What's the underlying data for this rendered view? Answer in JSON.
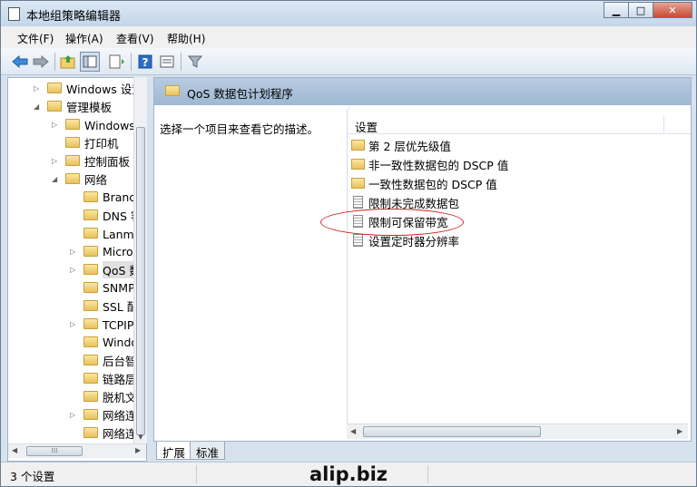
{
  "window": {
    "title": "本地组策略编辑器"
  },
  "menubar": {
    "items": [
      "文件(F)",
      "操作(A)",
      "查看(V)",
      "帮助(H)"
    ]
  },
  "toolbar": {
    "icons": [
      "back-icon",
      "forward-icon",
      "up-folder-icon",
      "show-hide-tree-icon",
      "export-list-icon",
      "help-icon",
      "properties-icon",
      "filter-icon"
    ]
  },
  "tree": {
    "items": [
      {
        "label": "Windows 设置",
        "indent": 1,
        "arrow": "▷"
      },
      {
        "label": "管理模板",
        "indent": 1,
        "arrow": "◢"
      },
      {
        "label": "Windows 组件",
        "indent": 2,
        "arrow": "▷"
      },
      {
        "label": "打印机",
        "indent": 2,
        "arrow": ""
      },
      {
        "label": "控制面板",
        "indent": 2,
        "arrow": "▷"
      },
      {
        "label": "网络",
        "indent": 2,
        "arrow": "◢"
      },
      {
        "label": "BranchCache",
        "indent": 3,
        "arrow": ""
      },
      {
        "label": "DNS 客户端",
        "indent": 3,
        "arrow": ""
      },
      {
        "label": "Lanman 工作站",
        "indent": 3,
        "arrow": ""
      },
      {
        "label": "Microsoft",
        "indent": 3,
        "arrow": "▷"
      },
      {
        "label": "QoS 数据包计划程序",
        "indent": 3,
        "arrow": "▷",
        "selected": true
      },
      {
        "label": "SNMP",
        "indent": 3,
        "arrow": ""
      },
      {
        "label": "SSL 配置设置",
        "indent": 3,
        "arrow": ""
      },
      {
        "label": "TCPIP 设置",
        "indent": 3,
        "arrow": "▷"
      },
      {
        "label": "Windows",
        "indent": 3,
        "arrow": ""
      },
      {
        "label": "后台智能传送",
        "indent": 3,
        "arrow": ""
      },
      {
        "label": "链路层拓扑",
        "indent": 3,
        "arrow": ""
      },
      {
        "label": "脱机文件",
        "indent": 3,
        "arrow": ""
      },
      {
        "label": "网络连接",
        "indent": 3,
        "arrow": "▷"
      },
      {
        "label": "网络连接状态",
        "indent": 3,
        "arrow": ""
      }
    ]
  },
  "right": {
    "header_title": "QoS 数据包计划程序",
    "description": "选择一个项目来查看它的描述。",
    "column_header": "设置",
    "items": [
      {
        "label": "第 2 层优先级值",
        "icon": "folder"
      },
      {
        "label": "非一致性数据包的 DSCP 值",
        "icon": "folder"
      },
      {
        "label": "一致性数据包的 DSCP 值",
        "icon": "folder"
      },
      {
        "label": "限制未完成数据包",
        "icon": "setting"
      },
      {
        "label": "限制可保留带宽",
        "icon": "setting"
      },
      {
        "label": "设置定时器分辨率",
        "icon": "setting"
      }
    ]
  },
  "tabs": {
    "extended": "扩展",
    "standard": "标准"
  },
  "status": {
    "text": "3 个设置",
    "watermark": "alip.biz"
  }
}
